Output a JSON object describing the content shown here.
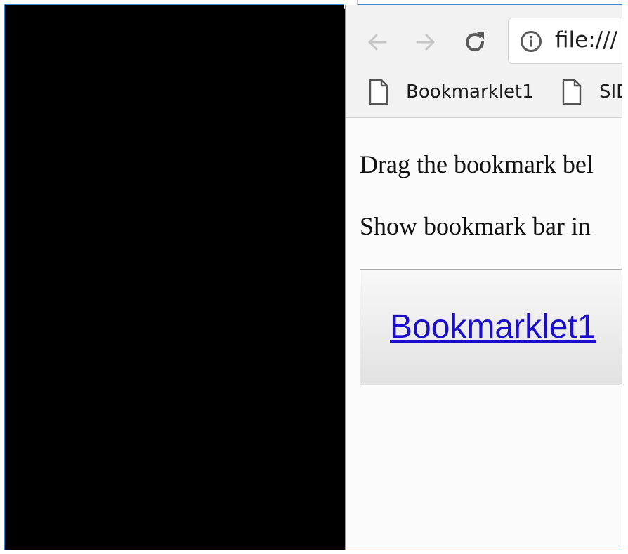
{
  "browser": {
    "address": "file:///",
    "bookmarks_bar": [
      {
        "label": "Bookmarklet1",
        "icon": "page-icon"
      },
      {
        "label": "SID",
        "icon": "page-icon"
      }
    ],
    "nav": {
      "back_icon": "arrow-left-icon",
      "forward_icon": "arrow-right-icon",
      "reload_icon": "reload-icon",
      "info_icon": "info-icon"
    }
  },
  "page": {
    "line1": "Drag the bookmark bel",
    "line2": "Show bookmark bar in",
    "bookmarklet_link": "Bookmarklet1"
  },
  "colors": {
    "window_border": "#3f86d0",
    "left_pane": "#000000",
    "link": "#1a0dcc"
  }
}
